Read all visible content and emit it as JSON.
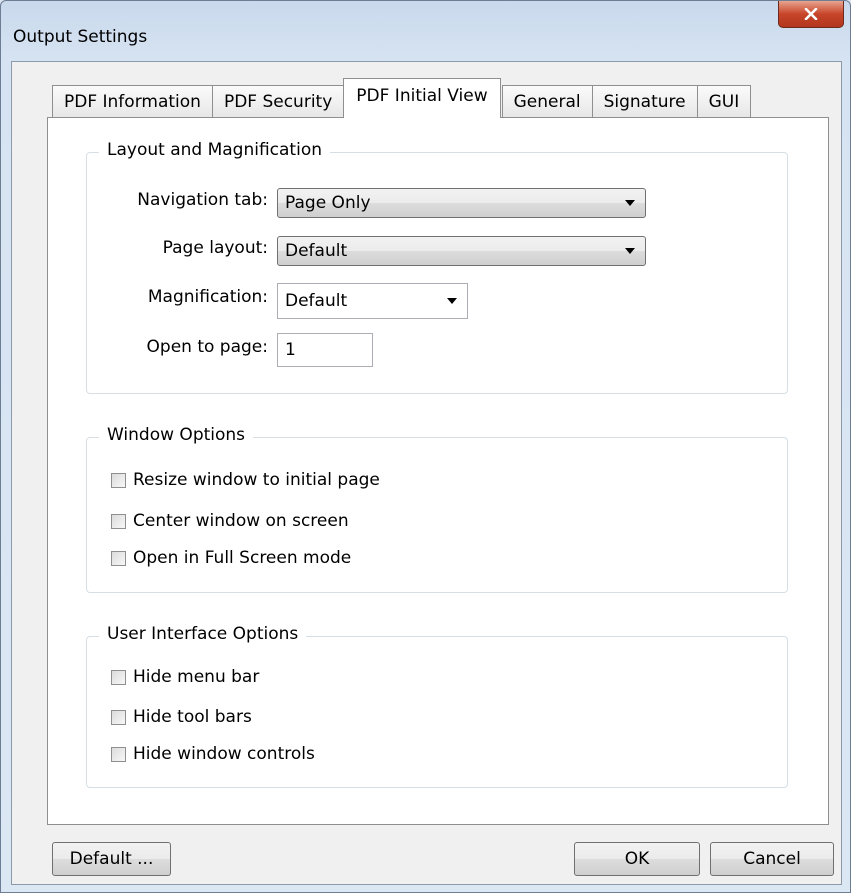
{
  "window": {
    "title": "Output Settings"
  },
  "tabs": [
    {
      "label": "PDF Information"
    },
    {
      "label": "PDF Security"
    },
    {
      "label": "PDF Initial View"
    },
    {
      "label": "General"
    },
    {
      "label": "Signature"
    },
    {
      "label": "GUI"
    }
  ],
  "active_tab": "PDF Initial View",
  "layout_group": {
    "title": "Layout and Magnification",
    "navigation_tab": {
      "label": "Navigation tab:",
      "value": "Page Only"
    },
    "page_layout": {
      "label": "Page layout:",
      "value": "Default"
    },
    "magnification": {
      "label": "Magnification:",
      "value": "Default"
    },
    "open_to_page": {
      "label": "Open to page:",
      "value": "1"
    }
  },
  "window_group": {
    "title": "Window Options",
    "options": [
      {
        "label": "Resize window to initial page",
        "checked": false
      },
      {
        "label": "Center window on screen",
        "checked": false
      },
      {
        "label": "Open in Full Screen mode",
        "checked": false
      }
    ]
  },
  "ui_group": {
    "title": "User Interface Options",
    "options": [
      {
        "label": "Hide menu bar",
        "checked": false
      },
      {
        "label": "Hide tool bars",
        "checked": false
      },
      {
        "label": "Hide window controls",
        "checked": false
      }
    ]
  },
  "buttons": {
    "default": "Default ...",
    "ok": "OK",
    "cancel": "Cancel"
  },
  "icons": {
    "close": "close-icon",
    "dropdown": "chevron-down-icon"
  },
  "colors": {
    "close_button": "#c7452a",
    "panel_bg": "#ffffff",
    "dialog_bg": "#f0f0f0",
    "frame": "#d6e3f2"
  }
}
